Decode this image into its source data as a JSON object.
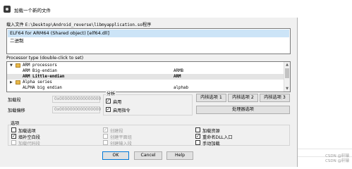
{
  "window": {
    "title": "加载一个新的文件"
  },
  "load_file": {
    "label": "载入文件",
    "path": "E:\\Desktop\\Android_reverse\\libmyapplication.so",
    "suffix": "程序"
  },
  "formats": [
    {
      "label": "ELF64 for ARM64 (Shared object) [elf64.dll]",
      "selected": true
    },
    {
      "label": "二进制",
      "selected": false
    }
  ],
  "processor": {
    "label": "Processor type (double-click to set)",
    "rows": [
      {
        "expander": "▼",
        "folder": true,
        "name": "ARM processors",
        "module": ""
      },
      {
        "expander": "",
        "folder": false,
        "name": "ARM Big-endian",
        "module": "ARMB"
      },
      {
        "expander": "",
        "folder": false,
        "name": "ARM Little-endian",
        "module": "ARM",
        "selected": true
      },
      {
        "expander": "▶",
        "folder": true,
        "name": "Alpha series",
        "module": ""
      },
      {
        "expander": "",
        "folder": false,
        "name": "ALPHA big endian",
        "module": "alphab"
      }
    ]
  },
  "load_segment": {
    "label": "加载段",
    "value": "0x0000000000000000"
  },
  "load_offset": {
    "label": "加载偏移",
    "value": "0x0000000000000000"
  },
  "analysis": {
    "title": "分析",
    "enabled": {
      "label": "启用",
      "checked": true
    },
    "indicator": {
      "label": "启用指令",
      "checked": true
    }
  },
  "kernel_buttons": [
    "内核选项 1",
    "内核选项 2",
    "内核选项 3"
  ],
  "processor_options_button": "处理器选项",
  "options": {
    "title": "选项",
    "col1": [
      {
        "label": "加载选项",
        "checked": false,
        "disabled": false
      },
      {
        "label": "填补空白段",
        "checked": true,
        "disabled": false
      },
      {
        "label": "加载代码段",
        "checked": false,
        "disabled": true
      }
    ],
    "col2": [
      {
        "label": "创建段",
        "checked": true,
        "disabled": true
      },
      {
        "label": "创建平面组",
        "checked": false,
        "disabled": true
      },
      {
        "label": "创建输入段",
        "checked": false,
        "disabled": true
      }
    ],
    "col3": [
      {
        "label": "加载资源",
        "checked": false,
        "disabled": false
      },
      {
        "label": "重命名DLL入口",
        "checked": true,
        "disabled": false
      },
      {
        "label": "手动加载",
        "checked": false,
        "disabled": false
      }
    ]
  },
  "buttons": {
    "ok": "OK",
    "cancel": "Cancel",
    "help": "Help"
  },
  "watermark": [
    "CSDN @轩辕",
    "CSDN @轩辕"
  ]
}
